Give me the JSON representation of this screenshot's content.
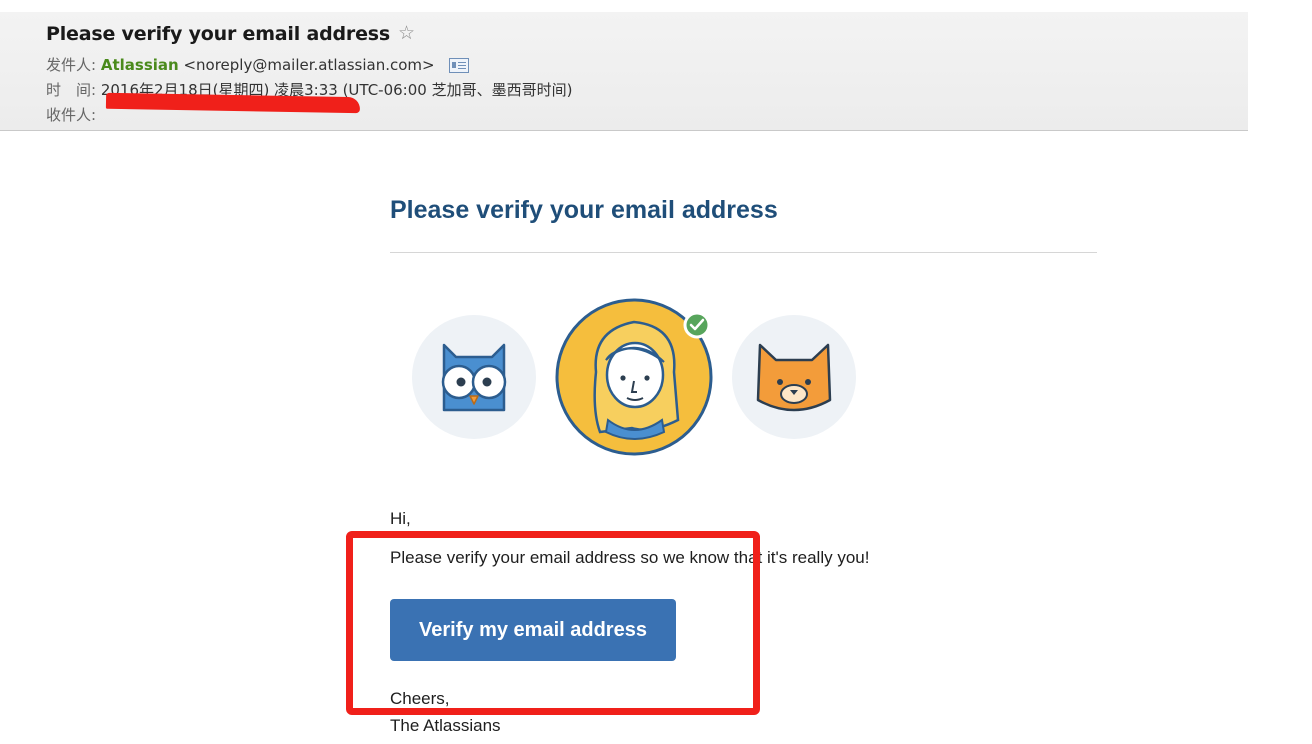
{
  "header": {
    "subject": "Please verify your email address",
    "from_label": "发件人:",
    "sender_name": "Atlassian",
    "sender_email": "<noreply@mailer.atlassian.com>",
    "time_label": "时　间:",
    "time_value": "2016年2月18日(星期四) 凌晨3:33 (UTC-06:00 芝加哥、墨西哥时间)",
    "to_label": "收件人:"
  },
  "email": {
    "title": "Please verify your email address",
    "greeting": "Hi,",
    "message": "Please verify your email address so we know that it's really you!",
    "button_label": "Verify my email address",
    "signoff": "Cheers,",
    "signature": "The Atlassians"
  },
  "icons": {
    "star": "star-icon",
    "contact_card": "contact-card-icon",
    "owl": "owl-avatar",
    "person": "person-avatar",
    "cat": "cat-avatar",
    "check": "check-icon"
  },
  "colors": {
    "title": "#1f4e79",
    "button": "#3a72b3",
    "sender": "#4a8a1c",
    "annotation": "#f0201a"
  }
}
